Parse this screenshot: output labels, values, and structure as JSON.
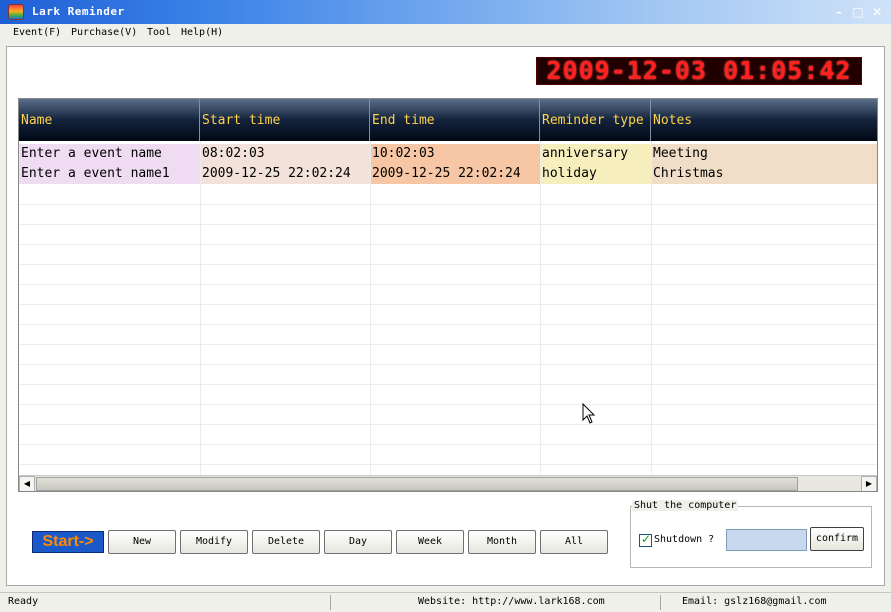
{
  "window": {
    "title": "Lark Reminder"
  },
  "menu": {
    "items": [
      "Event(F)",
      "Purchase(V)",
      "Tool",
      "Help(H)"
    ]
  },
  "clock": {
    "display": "2009-12-03 01:05:42"
  },
  "table": {
    "columns": [
      "Name",
      "Start time",
      "End time",
      "Reminder type",
      "Notes"
    ],
    "rows": [
      [
        "Enter a event name",
        "08:02:03",
        "10:02:03",
        "anniversary",
        "Meeting"
      ],
      [
        "Enter a event name1",
        "2009-12-25 22:02:24",
        "2009-12-25 22:02:24",
        "holiday",
        "Christmas"
      ]
    ]
  },
  "colors": {
    "col_name": "#f0dcf2",
    "col_start": "#f2e2da",
    "col_end": "#f7c6a4",
    "col_type": "#f6eebc",
    "col_notes": "#f1dec8",
    "header_text": "#ffd34a",
    "clock_text": "#ff2020"
  },
  "toolbar": {
    "start_label": "Start->",
    "buttons": [
      "New",
      "Modify",
      "Delete",
      "Day",
      "Week",
      "Month",
      "All"
    ]
  },
  "shutdown": {
    "group_title": "Shut the computer",
    "checkbox_label": "Shutdown ?",
    "checked": true,
    "confirm_label": "confirm"
  },
  "status": {
    "state": "Ready",
    "website": "Website: http://www.lark168.com",
    "email": "Email: gslz168@gmail.com"
  }
}
